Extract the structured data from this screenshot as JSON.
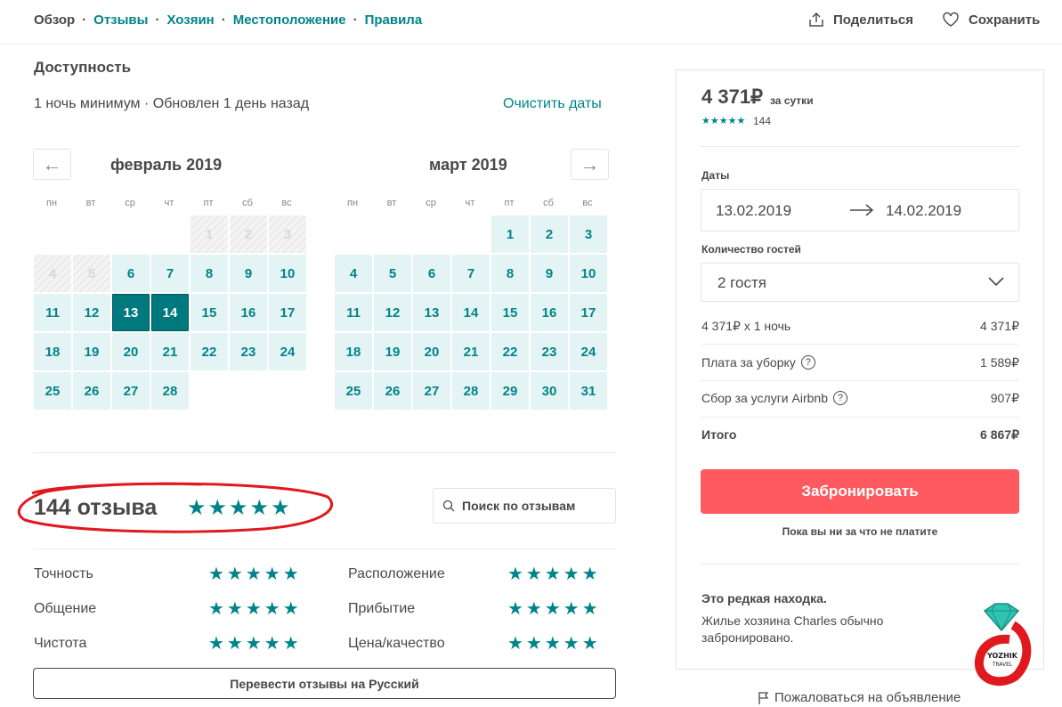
{
  "nav": {
    "items": [
      "Обзор",
      "Отзывы",
      "Хозяин",
      "Местоположение",
      "Правила"
    ],
    "separator": "·",
    "share_label": "Поделиться",
    "save_label": "Сохранить"
  },
  "availability": {
    "title": "Доступность",
    "subtitle": "1 ночь минимум · Обновлен 1 день назад",
    "clear_dates": "Очистить даты",
    "prev_arrow": "←",
    "next_arrow": "→",
    "weekdays": [
      "пн",
      "вт",
      "ср",
      "чт",
      "пт",
      "сб",
      "вс"
    ],
    "months": [
      {
        "title": "февраль 2019",
        "first_weekday": 4,
        "days": 28,
        "blocked": [
          1,
          2,
          3,
          4,
          5
        ],
        "selected": [
          13,
          14
        ]
      },
      {
        "title": "март 2019",
        "first_weekday": 4,
        "days": 31,
        "blocked": [],
        "selected": []
      }
    ]
  },
  "reviews": {
    "count_label": "144 отзыва",
    "stars": "★★★★★",
    "search_placeholder": "Поиск по отзывам",
    "categories": [
      {
        "label": "Точность",
        "stars": "★★★★★"
      },
      {
        "label": "Расположение",
        "stars": "★★★★★"
      },
      {
        "label": "Общение",
        "stars": "★★★★★"
      },
      {
        "label": "Прибытие",
        "stars": "★★★★★"
      },
      {
        "label": "Чистота",
        "stars": "★★★★★"
      },
      {
        "label": "Цена/качество",
        "stars": "★★★★★"
      }
    ],
    "translate_button": "Перевести отзывы на Русский"
  },
  "booking": {
    "price": "4 371₽",
    "per_night": "за сутки",
    "stars": "★★★★★",
    "review_count": "144",
    "dates_label": "Даты",
    "check_in": "13.02.2019",
    "check_out": "14.02.2019",
    "guests_label": "Количество гостей",
    "guests_value": "2 гостя",
    "lines": [
      {
        "label": "4 371₽ x 1 ночь",
        "value": "4 371₽",
        "help": false
      },
      {
        "label": "Плата за уборку",
        "value": "1 589₽",
        "help": true
      },
      {
        "label": "Сбор за услуги Airbnb",
        "value": "907₽",
        "help": true
      }
    ],
    "total_label": "Итого",
    "total_value": "6 867₽",
    "book_button": "Забронировать",
    "no_charge": "Пока вы ни за что не платите",
    "rare_title": "Это редкая находка.",
    "rare_text": "Жилье хозяина Charles обычно забронировано.",
    "report": "Пожаловаться на объявление"
  },
  "watermark": {
    "line1": "YOZHIK",
    "line2": "TRAVEL"
  },
  "colors": {
    "teal": "#008489",
    "selected": "#00797e",
    "book": "#ff5a5f",
    "annotation": "#e0191e"
  }
}
